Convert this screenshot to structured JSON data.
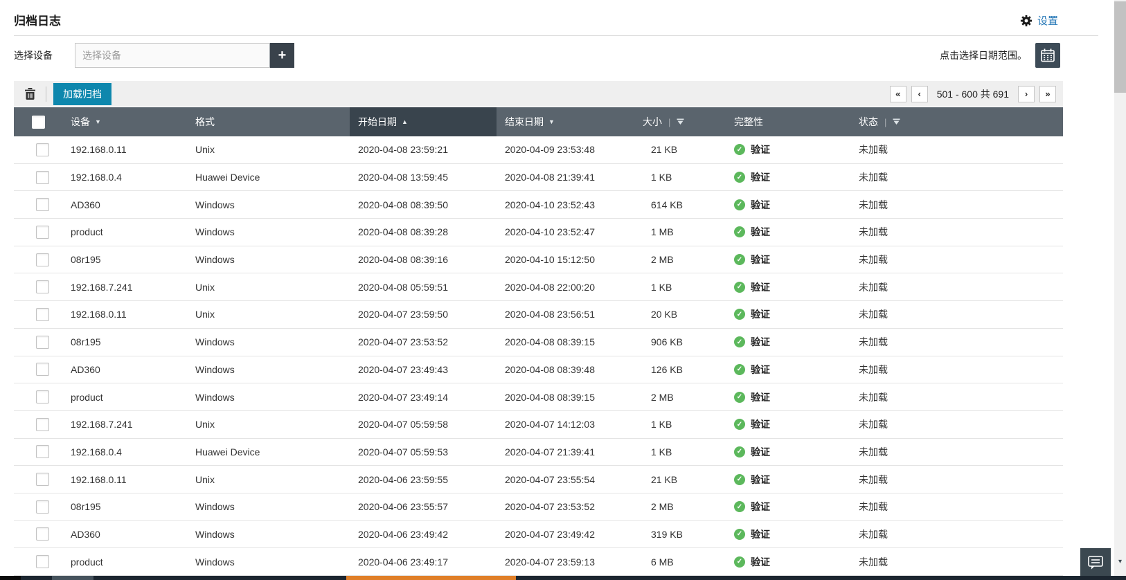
{
  "page": {
    "title": "归档日志",
    "settings_label": "设置",
    "date_range_hint": "点击选择日期范围。"
  },
  "filters": {
    "device_label": "选择设备",
    "device_placeholder": "选择设备",
    "add_button_glyph": "+"
  },
  "toolbar": {
    "load_label": "加载归档",
    "pagination": {
      "first_glyph": "«",
      "prev_glyph": "‹",
      "range_text": "501 - 600 共 691",
      "next_glyph": "›",
      "last_glyph": "»"
    }
  },
  "table": {
    "columns": {
      "device": "设备",
      "format": "格式",
      "start": "开始日期",
      "end": "结束日期",
      "size": "大小",
      "integrity": "完整性",
      "status": "状态"
    },
    "sort_glyphs": {
      "device": "▼",
      "start": "▲",
      "end": "▼"
    },
    "separator_glyph": "|",
    "rows": [
      {
        "device": "192.168.0.11",
        "format": "Unix",
        "start": "2020-04-08 23:59:21",
        "end": "2020-04-09 23:53:48",
        "size": "21 KB",
        "integrity": "验证",
        "status": "未加载"
      },
      {
        "device": "192.168.0.4",
        "format": "Huawei Device",
        "start": "2020-04-08 13:59:45",
        "end": "2020-04-08 21:39:41",
        "size": "1 KB",
        "integrity": "验证",
        "status": "未加载"
      },
      {
        "device": "AD360",
        "format": "Windows",
        "start": "2020-04-08 08:39:50",
        "end": "2020-04-10 23:52:43",
        "size": "614 KB",
        "integrity": "验证",
        "status": "未加载"
      },
      {
        "device": "product",
        "format": "Windows",
        "start": "2020-04-08 08:39:28",
        "end": "2020-04-10 23:52:47",
        "size": "1 MB",
        "integrity": "验证",
        "status": "未加载"
      },
      {
        "device": "08r195",
        "format": "Windows",
        "start": "2020-04-08 08:39:16",
        "end": "2020-04-10 15:12:50",
        "size": "2 MB",
        "integrity": "验证",
        "status": "未加载"
      },
      {
        "device": "192.168.7.241",
        "format": "Unix",
        "start": "2020-04-08 05:59:51",
        "end": "2020-04-08 22:00:20",
        "size": "1 KB",
        "integrity": "验证",
        "status": "未加载"
      },
      {
        "device": "192.168.0.11",
        "format": "Unix",
        "start": "2020-04-07 23:59:50",
        "end": "2020-04-08 23:56:51",
        "size": "20 KB",
        "integrity": "验证",
        "status": "未加载"
      },
      {
        "device": "08r195",
        "format": "Windows",
        "start": "2020-04-07 23:53:52",
        "end": "2020-04-08 08:39:15",
        "size": "906 KB",
        "integrity": "验证",
        "status": "未加载"
      },
      {
        "device": "AD360",
        "format": "Windows",
        "start": "2020-04-07 23:49:43",
        "end": "2020-04-08 08:39:48",
        "size": "126 KB",
        "integrity": "验证",
        "status": "未加载"
      },
      {
        "device": "product",
        "format": "Windows",
        "start": "2020-04-07 23:49:14",
        "end": "2020-04-08 08:39:15",
        "size": "2 MB",
        "integrity": "验证",
        "status": "未加载"
      },
      {
        "device": "192.168.7.241",
        "format": "Unix",
        "start": "2020-04-07 05:59:58",
        "end": "2020-04-07 14:12:03",
        "size": "1 KB",
        "integrity": "验证",
        "status": "未加载"
      },
      {
        "device": "192.168.0.4",
        "format": "Huawei Device",
        "start": "2020-04-07 05:59:53",
        "end": "2020-04-07 21:39:41",
        "size": "1 KB",
        "integrity": "验证",
        "status": "未加载"
      },
      {
        "device": "192.168.0.11",
        "format": "Unix",
        "start": "2020-04-06 23:59:55",
        "end": "2020-04-07 23:55:54",
        "size": "21 KB",
        "integrity": "验证",
        "status": "未加载"
      },
      {
        "device": "08r195",
        "format": "Windows",
        "start": "2020-04-06 23:55:57",
        "end": "2020-04-07 23:53:52",
        "size": "2 MB",
        "integrity": "验证",
        "status": "未加载"
      },
      {
        "device": "AD360",
        "format": "Windows",
        "start": "2020-04-06 23:49:42",
        "end": "2020-04-07 23:49:42",
        "size": "319 KB",
        "integrity": "验证",
        "status": "未加载"
      },
      {
        "device": "product",
        "format": "Windows",
        "start": "2020-04-06 23:49:17",
        "end": "2020-04-07 23:59:13",
        "size": "6 MB",
        "integrity": "验证",
        "status": "未加载"
      }
    ],
    "check_glyph": "✓"
  },
  "scrollbar": {
    "down_arrow_glyph": "▾"
  },
  "colors": {
    "accent_button": "#0e87ad",
    "link_blue": "#2b7bb9",
    "header_bg": "#5a646d",
    "header_sorted_bg": "#39444d",
    "success_green": "#5cb85c",
    "dark_button": "#3d4b57",
    "taskbar_orange": "#e07f28"
  }
}
